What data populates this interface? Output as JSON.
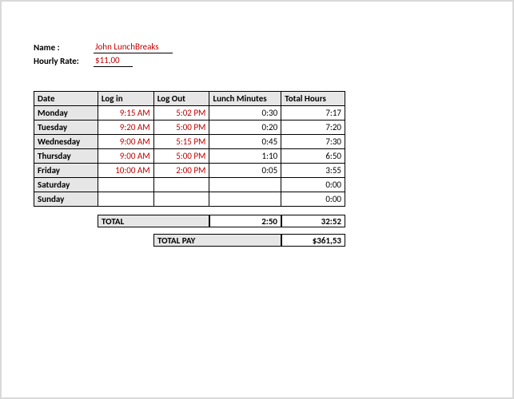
{
  "header": {
    "name_label": "Name :",
    "name_value": "John LunchBreaks",
    "rate_label": "Hourly Rate:",
    "rate_value": "$11,00"
  },
  "table": {
    "headers": {
      "date": "Date",
      "login": "Log in",
      "logout": "Log Out",
      "lunch": "Lunch Minutes",
      "total": "Total Hours"
    },
    "rows": [
      {
        "day": "Monday",
        "login": "9:15 AM",
        "logout": "5:02 PM",
        "lunch": "0:30",
        "total": "7:17"
      },
      {
        "day": "Tuesday",
        "login": "9:20 AM",
        "logout": "5:00 PM",
        "lunch": "0:20",
        "total": "7:20"
      },
      {
        "day": "Wednesday",
        "login": "9:00 AM",
        "logout": "5:15 PM",
        "lunch": "0:45",
        "total": "7:30"
      },
      {
        "day": "Thursday",
        "login": "9:00 AM",
        "logout": "5:00 PM",
        "lunch": "1:10",
        "total": "6:50"
      },
      {
        "day": "Friday",
        "login": "10:00 AM",
        "logout": "2:00 PM",
        "lunch": "0:05",
        "total": "3:55"
      },
      {
        "day": "Saturday",
        "login": "",
        "logout": "",
        "lunch": "",
        "total": "0:00"
      },
      {
        "day": "Sunday",
        "login": "",
        "logout": "",
        "lunch": "",
        "total": "0:00"
      }
    ]
  },
  "totals": {
    "total_label": "TOTAL",
    "total_lunch": "2:50",
    "total_hours": "32:52",
    "pay_label": "TOTAL PAY",
    "pay_value": "$361,53"
  }
}
